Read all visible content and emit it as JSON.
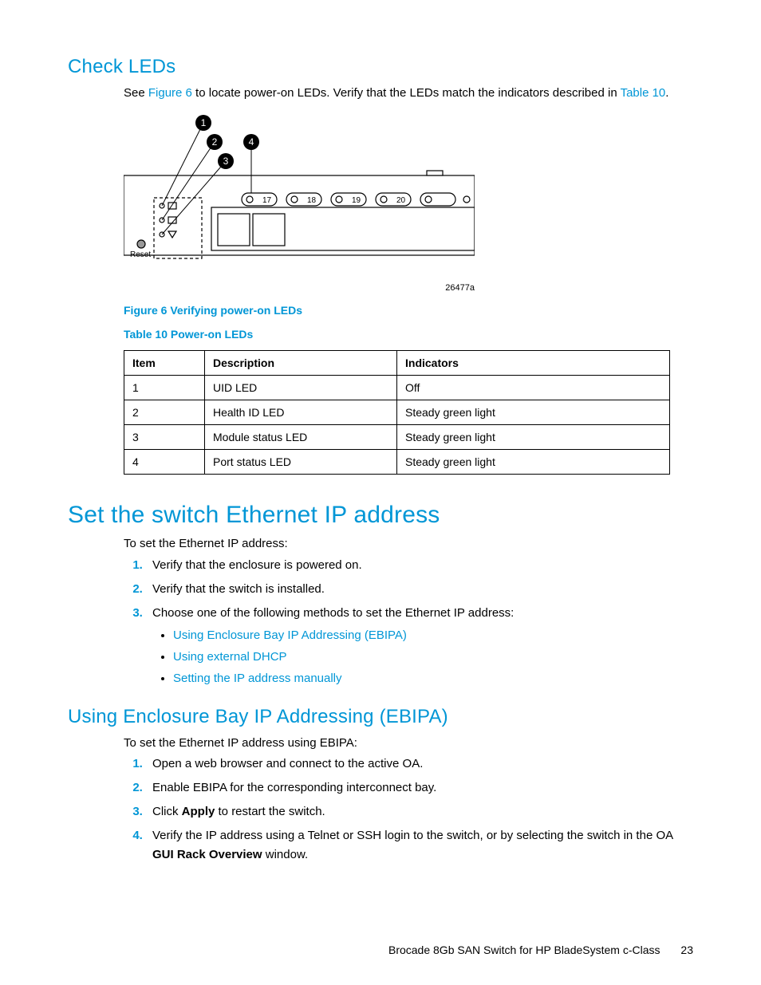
{
  "section1": {
    "heading": "Check LEDs",
    "intro_pre": "See ",
    "intro_link1": "Figure 6",
    "intro_mid": " to locate power-on LEDs. Verify that the LEDs match the indicators described in ",
    "intro_link2": "Table 10",
    "intro_post": "."
  },
  "diagram": {
    "callouts": {
      "c1": "1",
      "c2": "2",
      "c3": "3",
      "c4": "4"
    },
    "ports": {
      "p17": "17",
      "p18": "18",
      "p19": "19",
      "p20": "20"
    },
    "reset_label": "Reset",
    "id": "26477a"
  },
  "figure_caption": "Figure 6 Verifying power-on LEDs",
  "table_caption": "Table 10 Power-on LEDs",
  "table": {
    "headers": {
      "item": "Item",
      "desc": "Description",
      "ind": "Indicators"
    },
    "rows": [
      {
        "item": "1",
        "desc": "UID LED",
        "ind": "Off"
      },
      {
        "item": "2",
        "desc": "Health ID LED",
        "ind": "Steady green light"
      },
      {
        "item": "3",
        "desc": "Module status LED",
        "ind": "Steady green light"
      },
      {
        "item": "4",
        "desc": "Port status LED",
        "ind": "Steady green light"
      }
    ]
  },
  "section2": {
    "heading": "Set the switch Ethernet IP address",
    "intro": "To set the Ethernet IP address:",
    "steps": {
      "s1": "Verify that the enclosure is powered on.",
      "s2": "Verify that the switch is installed.",
      "s3": "Choose one of the following methods to set the Ethernet IP address:"
    },
    "bullets": {
      "b1": "Using Enclosure Bay IP Addressing (EBIPA)",
      "b2": "Using external DHCP",
      "b3": "Setting the IP address manually"
    }
  },
  "section3": {
    "heading": "Using Enclosure Bay IP Addressing (EBIPA)",
    "intro": "To set the Ethernet IP address using EBIPA:",
    "steps": {
      "s1": "Open a web browser and connect to the active OA.",
      "s2": "Enable EBIPA for the corresponding interconnect bay.",
      "s3_pre": "Click ",
      "s3_bold": "Apply",
      "s3_post": " to restart the switch.",
      "s4_pre": "Verify the IP address using a Telnet or SSH login to the switch, or by selecting the switch in the OA ",
      "s4_bold": "GUI Rack Overview",
      "s4_post": " window."
    }
  },
  "footer": {
    "title": "Brocade 8Gb SAN Switch for HP BladeSystem c-Class",
    "page": "23"
  }
}
